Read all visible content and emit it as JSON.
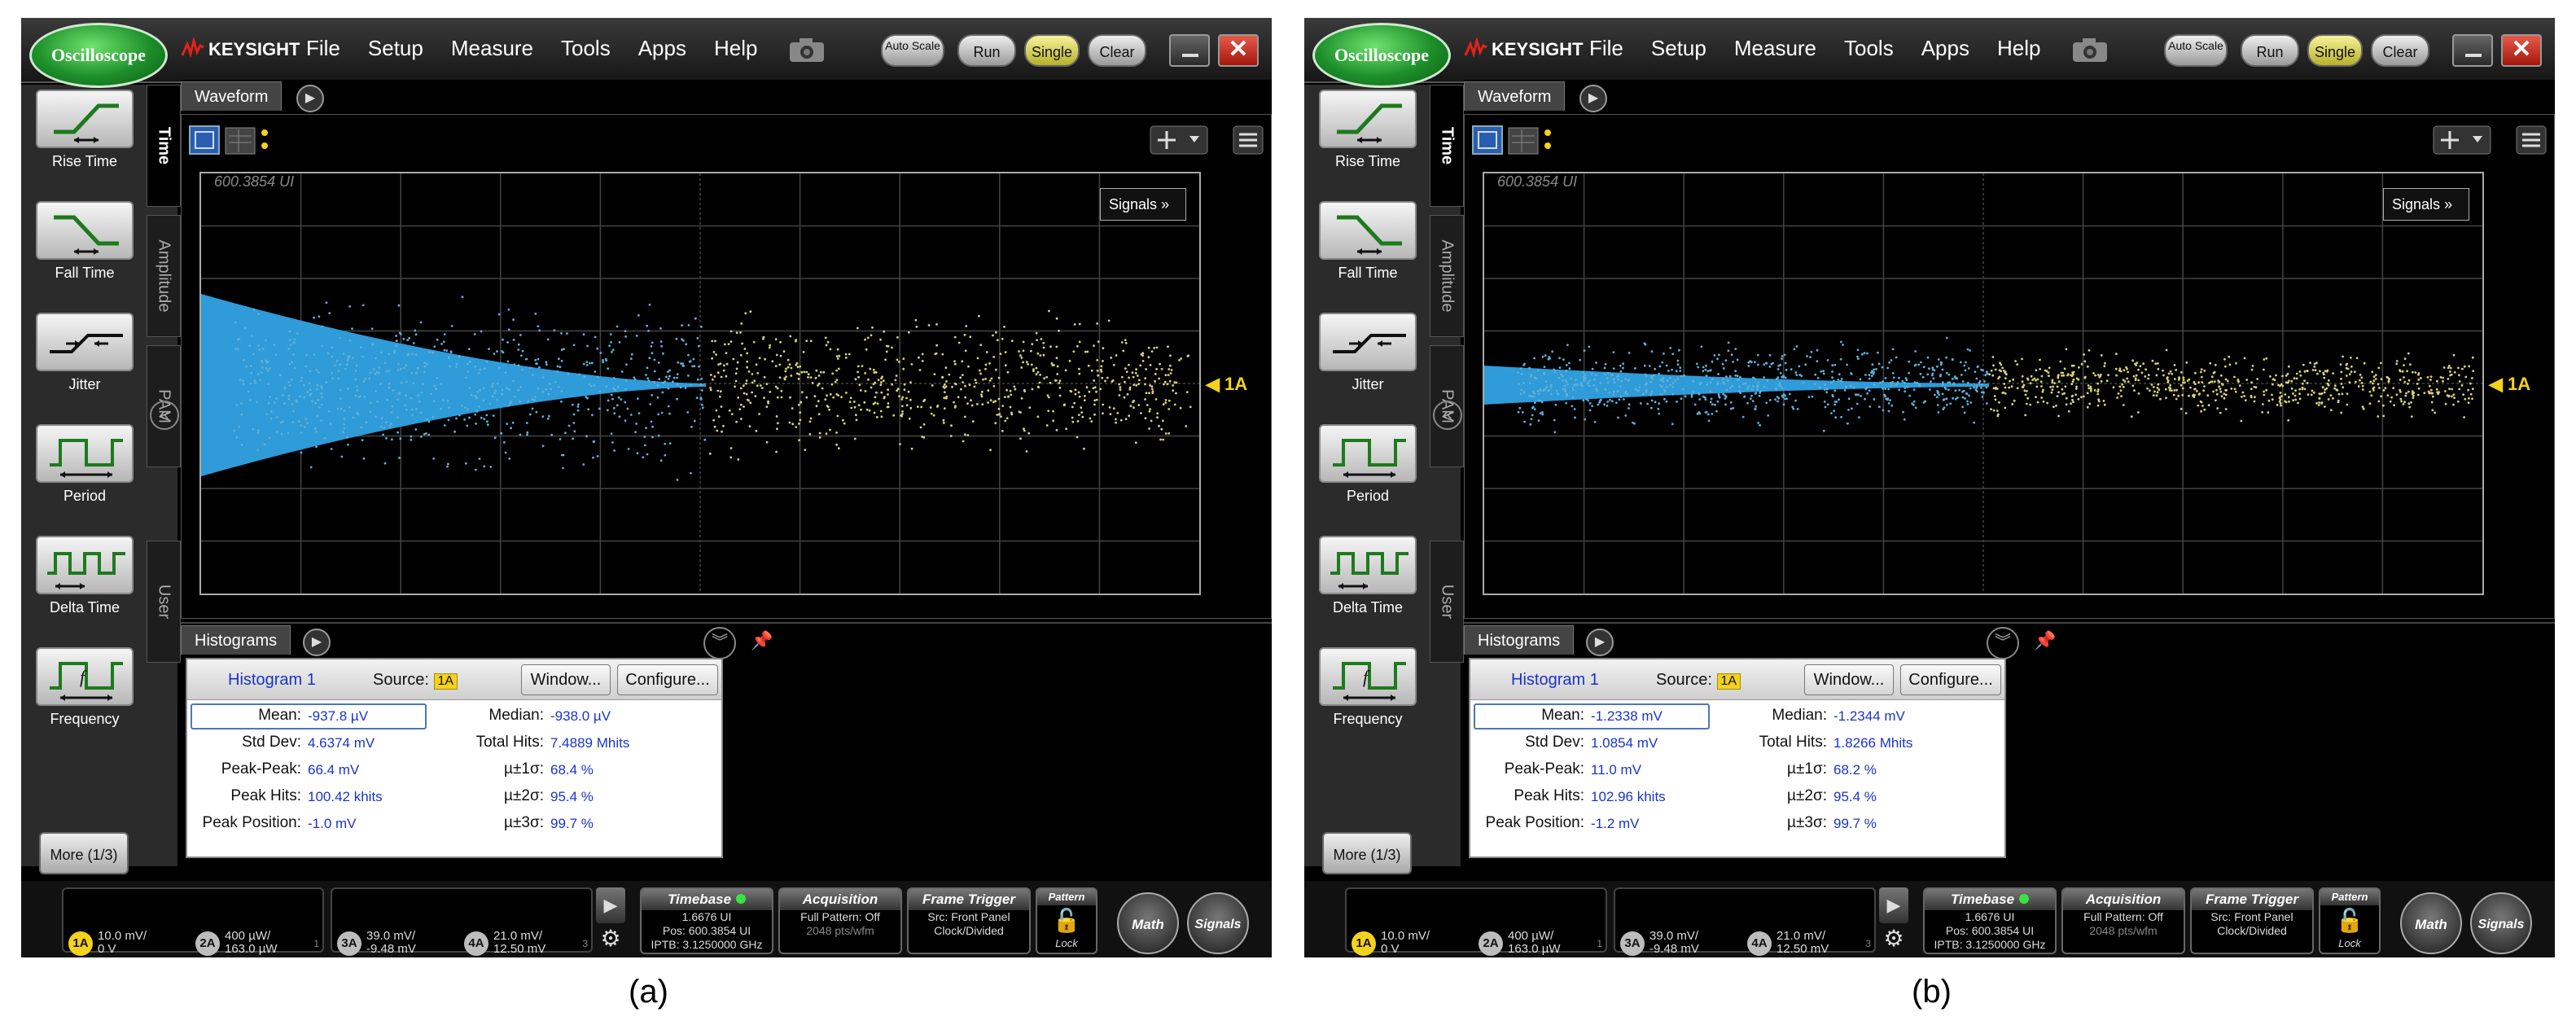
{
  "panels": [
    {
      "caption": "(a)",
      "app_badge": "Oscilloscope",
      "brand": "KEYSIGHT",
      "menu": [
        "File",
        "Setup",
        "Measure",
        "Tools",
        "Apps",
        "Help"
      ],
      "toolbar": {
        "auto_scale": "Auto Scale",
        "run": "Run",
        "single": "Single",
        "clear": "Clear",
        "close": "✕"
      },
      "measurements": [
        "Rise Time",
        "Fall Time",
        "Jitter",
        "Period",
        "Delta Time",
        "Frequency"
      ],
      "more_button": "More (1/3)",
      "side_tabs": [
        "Time",
        "Amplitude",
        "PAM",
        "User"
      ],
      "waveform_tab": "Waveform",
      "signals_button": "Signals",
      "position_label": "600.3854 UI",
      "channel_marker": "1A",
      "histograms_tab": "Histograms",
      "histogram": {
        "name": "Histogram 1",
        "source_label": "Source:",
        "source": "1A",
        "window_button": "Window...",
        "configure_button": "Configure...",
        "stats_left": [
          {
            "label": "Mean:",
            "value": "-937.8 µV"
          },
          {
            "label": "Std Dev:",
            "value": "4.6374 mV"
          },
          {
            "label": "Peak-Peak:",
            "value": "66.4 mV"
          },
          {
            "label": "Peak Hits:",
            "value": "100.42 khits"
          },
          {
            "label": "Peak Position:",
            "value": "-1.0 mV"
          }
        ],
        "stats_right": [
          {
            "label": "Median:",
            "value": "-938.0 µV"
          },
          {
            "label": "Total Hits:",
            "value": "7.4889 Mhits"
          },
          {
            "label": "µ±1σ:",
            "value": "68.4 %"
          },
          {
            "label": "µ±2σ:",
            "value": "95.4 %"
          },
          {
            "label": "µ±3σ:",
            "value": "99.7 %"
          }
        ]
      },
      "waveform": {
        "spread": 1.0
      },
      "channels_group1": {
        "page": "1",
        "ch": [
          {
            "name": "1A",
            "l1": "10.0 mV/",
            "l2": "0 V",
            "color": "#f4d21c"
          },
          {
            "name": "2A",
            "l1": "400 µW/",
            "l2": "163.0 µW",
            "color": "#bdbdbd"
          }
        ]
      },
      "channels_group2": {
        "page": "3",
        "ch": [
          {
            "name": "3A",
            "l1": "39.0 mV/",
            "l2": "-9.48 mV",
            "color": "#bdbdbd"
          },
          {
            "name": "4A",
            "l1": "21.0 mV/",
            "l2": "12.50 mV",
            "color": "#bdbdbd"
          }
        ]
      },
      "timebase": {
        "title": "Timebase",
        "l1": "1.6676 UI",
        "l2": "Pos: 600.3854 UI",
        "l3": "IPTB: 3.1250000 GHz"
      },
      "acquisition": {
        "title": "Acquisition",
        "l1": "Full Pattern: Off",
        "l2": "2048 pts/wfm"
      },
      "frame_trigger": {
        "title": "Frame Trigger",
        "l1": "Src: Front Panel",
        "l2": "Clock/Divided"
      },
      "pattern": {
        "title": "Pattern",
        "lock": "Lock"
      },
      "math_button": "Math",
      "signals_round": "Signals"
    },
    {
      "caption": "(b)",
      "app_badge": "Oscilloscope",
      "brand": "KEYSIGHT",
      "menu": [
        "File",
        "Setup",
        "Measure",
        "Tools",
        "Apps",
        "Help"
      ],
      "toolbar": {
        "auto_scale": "Auto Scale",
        "run": "Run",
        "single": "Single",
        "clear": "Clear",
        "close": "✕"
      },
      "measurements": [
        "Rise Time",
        "Fall Time",
        "Jitter",
        "Period",
        "Delta Time",
        "Frequency"
      ],
      "more_button": "More (1/3)",
      "side_tabs": [
        "Time",
        "Amplitude",
        "PAM",
        "User"
      ],
      "waveform_tab": "Waveform",
      "signals_button": "Signals",
      "position_label": "600.3854 UI",
      "channel_marker": "1A",
      "histograms_tab": "Histograms",
      "histogram": {
        "name": "Histogram 1",
        "source_label": "Source:",
        "source": "1A",
        "window_button": "Window...",
        "configure_button": "Configure...",
        "stats_left": [
          {
            "label": "Mean:",
            "value": "-1.2338 mV"
          },
          {
            "label": "Std Dev:",
            "value": "1.0854 mV"
          },
          {
            "label": "Peak-Peak:",
            "value": "11.0 mV"
          },
          {
            "label": "Peak Hits:",
            "value": "102.96 khits"
          },
          {
            "label": "Peak Position:",
            "value": "-1.2 mV"
          }
        ],
        "stats_right": [
          {
            "label": "Median:",
            "value": "-1.2344 mV"
          },
          {
            "label": "Total Hits:",
            "value": "1.8266 Mhits"
          },
          {
            "label": "µ±1σ:",
            "value": "68.2 %"
          },
          {
            "label": "µ±2σ:",
            "value": "95.4 %"
          },
          {
            "label": "µ±3σ:",
            "value": "99.7 %"
          }
        ]
      },
      "waveform": {
        "spread": 0.2
      },
      "channels_group1": {
        "page": "1",
        "ch": [
          {
            "name": "1A",
            "l1": "10.0 mV/",
            "l2": "0 V",
            "color": "#f4d21c"
          },
          {
            "name": "2A",
            "l1": "400 µW/",
            "l2": "163.0 µW",
            "color": "#bdbdbd"
          }
        ]
      },
      "channels_group2": {
        "page": "3",
        "ch": [
          {
            "name": "3A",
            "l1": "39.0 mV/",
            "l2": "-9.48 mV",
            "color": "#bdbdbd"
          },
          {
            "name": "4A",
            "l1": "21.0 mV/",
            "l2": "12.50 mV",
            "color": "#bdbdbd"
          }
        ]
      },
      "timebase": {
        "title": "Timebase",
        "l1": "1.6676 UI",
        "l2": "Pos: 600.3854 UI",
        "l3": "IPTB: 3.1250000 GHz"
      },
      "acquisition": {
        "title": "Acquisition",
        "l1": "Full Pattern: Off",
        "l2": "2048 pts/wfm"
      },
      "frame_trigger": {
        "title": "Frame Trigger",
        "l1": "Src: Front Panel",
        "l2": "Clock/Divided"
      },
      "pattern": {
        "title": "Pattern",
        "lock": "Lock"
      },
      "math_button": "Math",
      "signals_round": "Signals"
    }
  ]
}
